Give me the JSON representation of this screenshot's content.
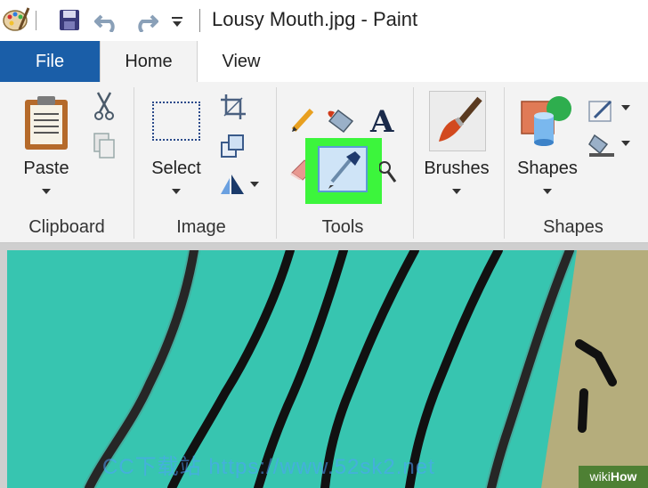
{
  "window": {
    "title": "Lousy Mouth.jpg - Paint"
  },
  "tabs": [
    {
      "label": "File"
    },
    {
      "label": "Home"
    },
    {
      "label": "View"
    }
  ],
  "ribbon": {
    "clipboard": {
      "paste_label": "Paste",
      "group_label": "Clipboard"
    },
    "image": {
      "select_label": "Select",
      "group_label": "Image"
    },
    "tools": {
      "group_label": "Tools"
    },
    "brushes": {
      "label": "Brushes"
    },
    "shapes": {
      "label": "Shapes",
      "group_label": "Shapes"
    }
  },
  "icons": {
    "app": "paint-palette-icon",
    "save": "save-icon",
    "undo": "undo-icon",
    "redo": "redo-icon",
    "customize": "chevron-down-icon",
    "cut": "scissors-icon",
    "copy": "copy-icon",
    "crop": "crop-icon",
    "resize": "resize-icon",
    "rotate": "rotate-icon",
    "pencil": "pencil-icon",
    "fill": "fill-bucket-icon",
    "text": "text-icon",
    "eraser": "eraser-icon",
    "color_picker": "eyedropper-icon",
    "magnifier": "magnifier-icon"
  },
  "colors": {
    "file_tab": "#1a5ea8",
    "highlight": "#3cf53c",
    "canvas_teal": "#37c5b0",
    "canvas_tan": "#b5ad7c"
  },
  "watermark": {
    "text": "CC下载站 https://www.52sk2.net"
  },
  "badge": {
    "wiki": "wiki",
    "how": "How"
  }
}
